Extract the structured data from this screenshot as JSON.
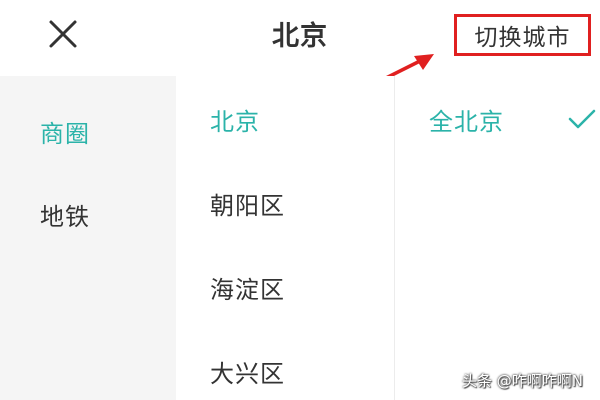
{
  "header": {
    "title": "北京",
    "close_icon": "close-icon",
    "switch_city_label": "切换城市"
  },
  "colors": {
    "accent": "#2bb3a9",
    "annotation": "#e02020",
    "text": "#333333",
    "left_panel_bg": "#f5f5f5"
  },
  "categories": [
    {
      "label": "商圈",
      "active": true
    },
    {
      "label": "地铁",
      "active": false
    }
  ],
  "districts": [
    {
      "label": "北京",
      "active": true
    },
    {
      "label": "朝阳区",
      "active": false
    },
    {
      "label": "海淀区",
      "active": false
    },
    {
      "label": "大兴区",
      "active": false
    }
  ],
  "areas": [
    {
      "label": "全北京",
      "selected": true,
      "icon": "check-icon"
    }
  ],
  "watermark": "头条 @咋啊咋啊N"
}
